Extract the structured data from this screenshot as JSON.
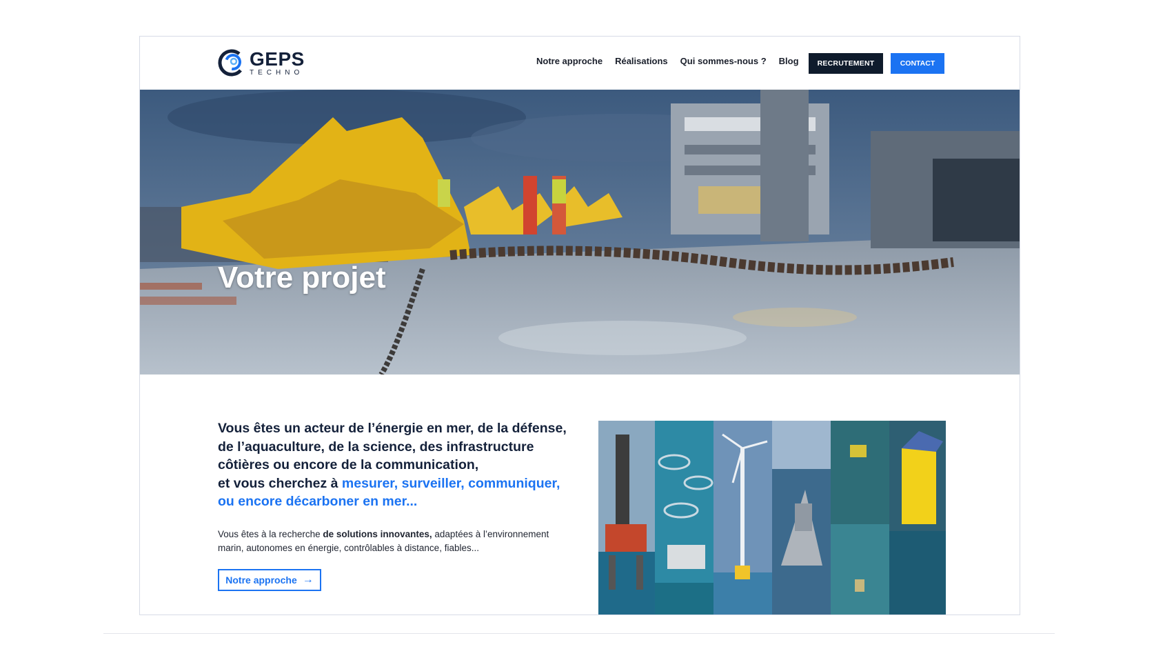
{
  "header": {
    "logo_word": "GEPS",
    "logo_sub": "TECHNO",
    "nav": [
      "Notre approche",
      "Réalisations",
      "Qui sommes-nous ?",
      "Blog"
    ],
    "recrutement_label": "RECRUTEMENT",
    "contact_label": "CONTACT"
  },
  "hero": {
    "title": "Votre projet"
  },
  "main": {
    "intro_line1": "Vous êtes un acteur de l’énergie en mer, de la défense,",
    "intro_line2": "de l’aquaculture, de la science, des infrastructure",
    "intro_line3": "côtières ou encore de la communication,",
    "intro_line4_prefix": "et vous cherchez à",
    "intro_highlight": "mesurer, surveiller, communiquer, ou encore décarboner en mer...",
    "desc_prefix": "Vous êtes à la recherche",
    "desc_bold": "de solutions innovantes,",
    "desc_suffix": "adaptées à l’environnement marin, autonomes en énergie, contrôlables à distance, fiables...",
    "cta_label": "Notre approche"
  },
  "colors": {
    "accent": "#1b73f2",
    "dark": "#0f1b2c",
    "text": "#14213a"
  },
  "icons": {
    "logo": "geps-swirl-logo",
    "cta": "arrow-right-icon"
  }
}
